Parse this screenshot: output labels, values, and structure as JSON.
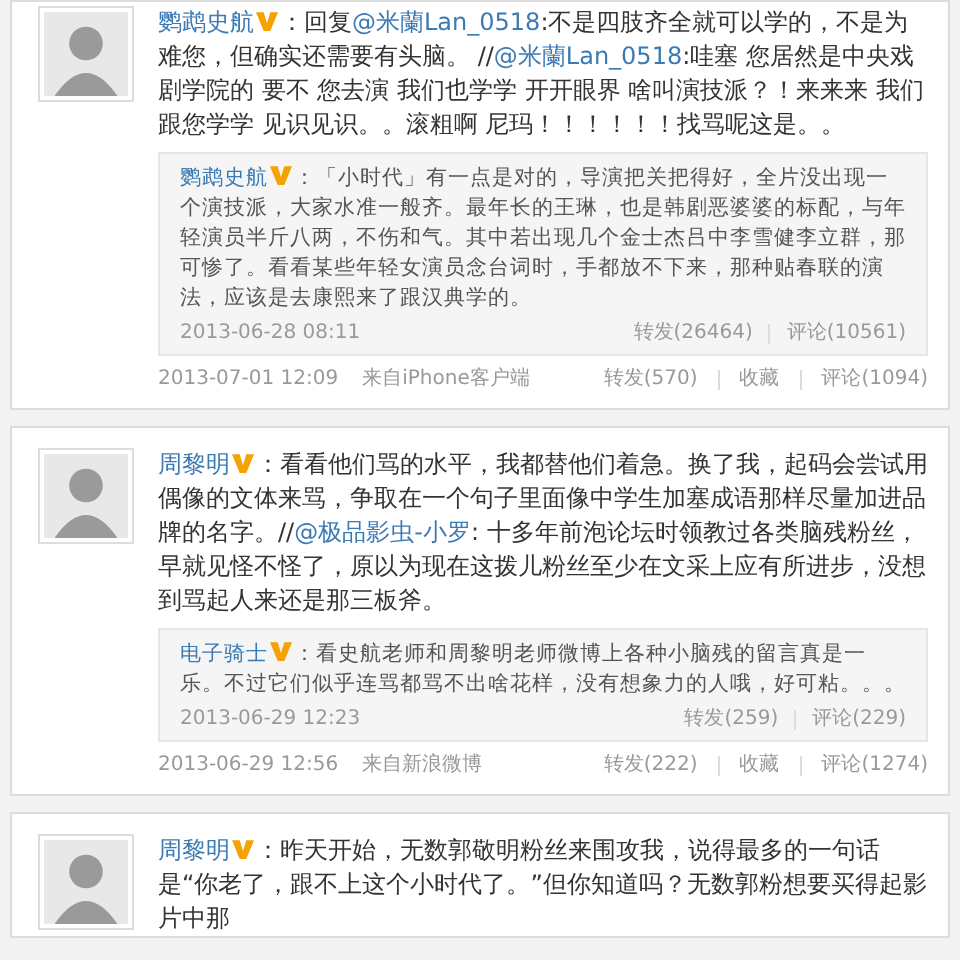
{
  "posts": [
    {
      "author": "鹦鹉史航",
      "verified": true,
      "text": [
        {
          "kind": "text",
          "text": "：回复"
        },
        {
          "kind": "mention",
          "text": "@米蘭Lan_0518"
        },
        {
          "kind": "text",
          "text": ":不是四肢齐全就可以学的，不是为难您，但确实还需要有头脑。 //"
        },
        {
          "kind": "mention",
          "text": "@米蘭Lan_0518"
        },
        {
          "kind": "text",
          "text": ":哇塞 您居然是中央戏剧学院的 要不 您去演 我们也学学 开开眼界 啥叫演技派？！来来来 我们跟您学学 见识见识。。滚粗啊 尼玛！！！！！！找骂呢这是。。"
        }
      ],
      "quote": {
        "author": "鹦鹉史航",
        "verified": true,
        "text": "：「小时代」有一点是对的，导演把关把得好，全片没出现一个演技派，大家水准一般齐。最年长的王琳，也是韩剧恶婆婆的标配，与年轻演员半斤八两，不伤和气。其中若出现几个金士杰吕中李雪健李立群，那可惨了。看看某些年轻女演员念台词时，手都放不下来，那种贴春联的演法，应该是去康熙来了跟汉典学的。",
        "time": "2013-06-28 08:11",
        "repost": "转发(26464)",
        "comment": "评论(10561)"
      },
      "time": "2013-07-01 12:09",
      "source": "来自iPhone客户端",
      "repost": "转发(570)",
      "favorite": "收藏",
      "comment": "评论(1094)"
    },
    {
      "author": "周黎明",
      "verified": true,
      "text": [
        {
          "kind": "text",
          "text": "：看看他们骂的水平，我都替他们着急。换了我，起码会尝试用偶像的文体来骂，争取在一个句子里面像中学生加塞成语那样尽量加进品牌的名字。//"
        },
        {
          "kind": "mention",
          "text": "@极品影虫-小罗"
        },
        {
          "kind": "text",
          "text": ": 十多年前泡论坛时领教过各类脑残粉丝，早就见怪不怪了，原以为现在这拨儿粉丝至少在文采上应有所进步，没想到骂起人来还是那三板斧。"
        }
      ],
      "quote": {
        "author": "电子骑士",
        "verified": true,
        "text": "：看史航老师和周黎明老师微博上各种小脑残的留言真是一乐。不过它们似乎连骂都骂不出啥花样，没有想象力的人哦，好可粘。。。",
        "time": "2013-06-29 12:23",
        "repost": "转发(259)",
        "comment": "评论(229)"
      },
      "time": "2013-06-29 12:56",
      "source": "来自新浪微博",
      "repost": "转发(222)",
      "favorite": "收藏",
      "comment": "评论(1274)"
    },
    {
      "author": "周黎明",
      "verified": true,
      "text": [
        {
          "kind": "text",
          "text": "：昨天开始，无数郭敬明粉丝来围攻我，说得最多的一句话是“你老了，跟不上这个小时代了。”但你知道吗？无数郭粉想要买得起影片中那"
        }
      ]
    }
  ]
}
